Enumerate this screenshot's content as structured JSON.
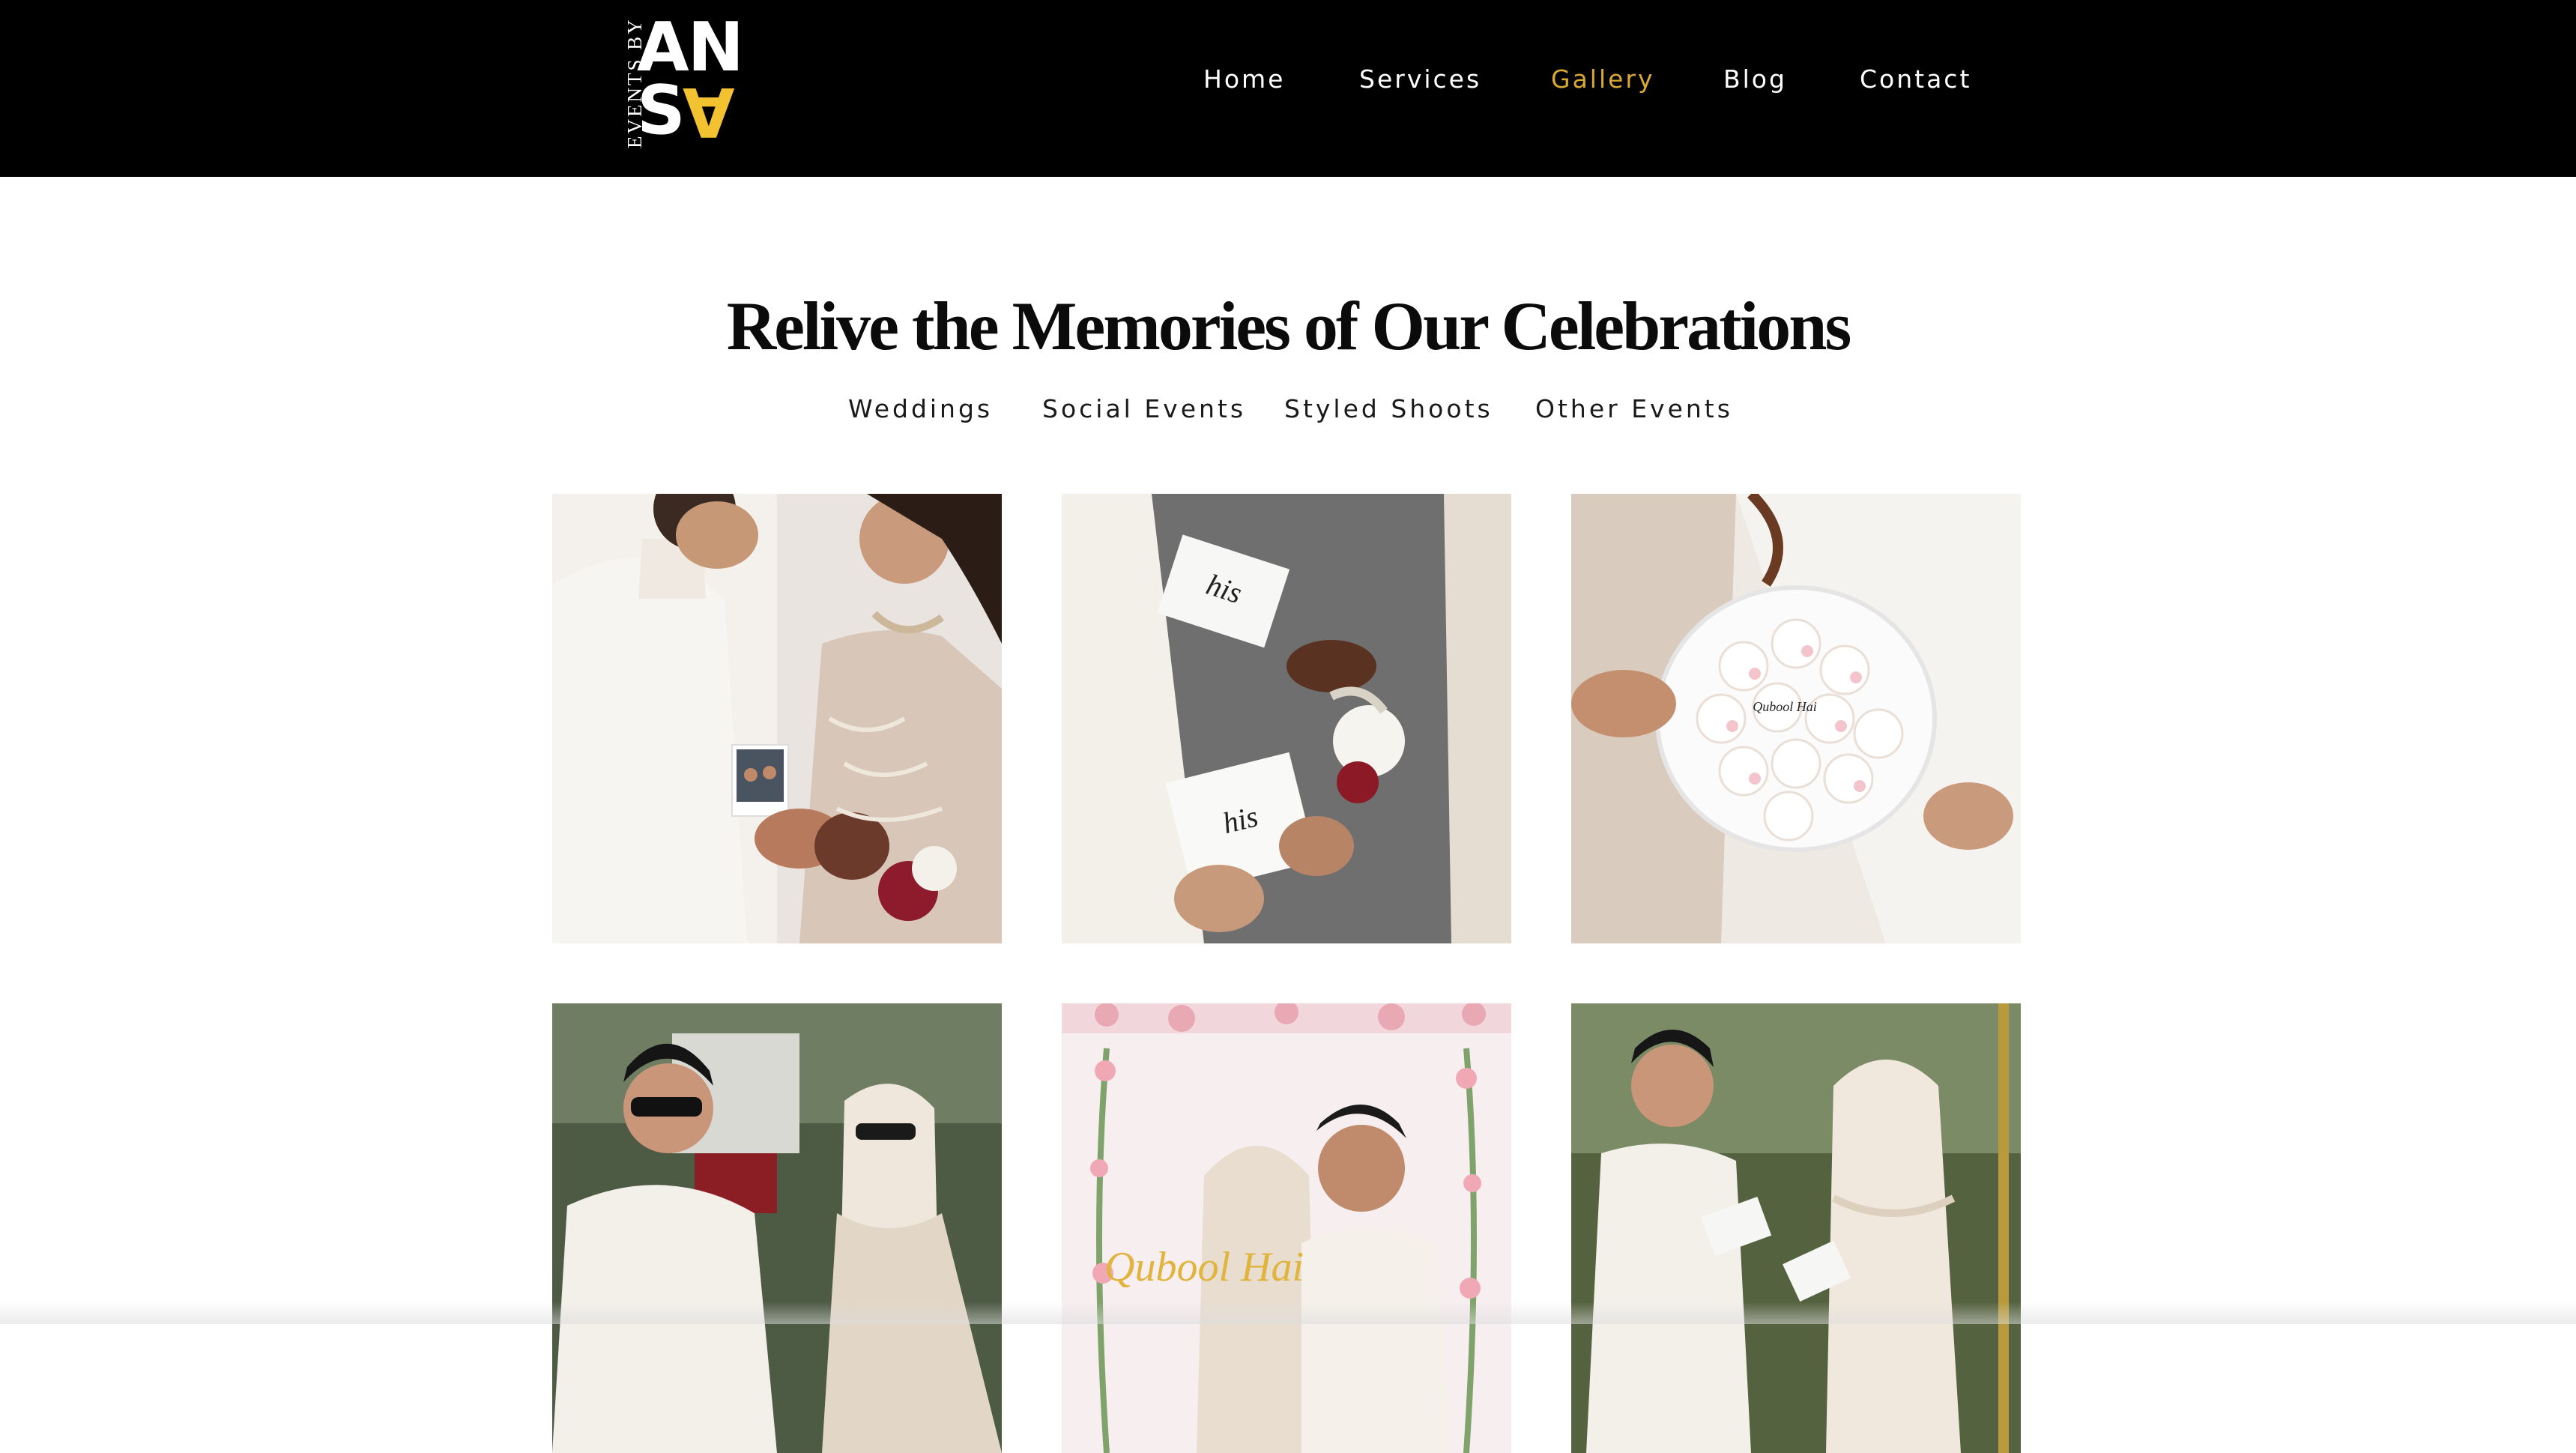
{
  "header": {
    "logo": {
      "vertical_text": "EVENTS BY",
      "line1": "AN",
      "line2": "SA"
    },
    "nav": [
      {
        "label": "Home"
      },
      {
        "label": "Services"
      },
      {
        "label": "Gallery",
        "active": true
      },
      {
        "label": "Blog"
      },
      {
        "label": "Contact"
      }
    ]
  },
  "main": {
    "title": "Relive the Memories of Our Celebrations",
    "filters": [
      {
        "label": "Weddings"
      },
      {
        "label": "Social Events"
      },
      {
        "label": "Styled Shoots"
      },
      {
        "label": "Other Events"
      }
    ],
    "gallery": [
      {
        "subject": "couple-with-polaroid-photo"
      },
      {
        "subject": "vow-books-exchange",
        "card_text_top": "his",
        "card_text_bottom": "his"
      },
      {
        "subject": "tray-of-heart-cookies",
        "cookie_text": "Qubool Hai"
      },
      {
        "subject": "couple-laughing-outdoors"
      },
      {
        "subject": "couple-under-floral-arch",
        "sign_text": "Qubool Hai"
      },
      {
        "subject": "couple-reading-vows"
      }
    ]
  },
  "colors": {
    "header_bg": "#000000",
    "nav_text": "#ffffff",
    "nav_active": "#d9a931",
    "logo_accent": "#f2c230",
    "title_text": "#0b0b0b"
  }
}
